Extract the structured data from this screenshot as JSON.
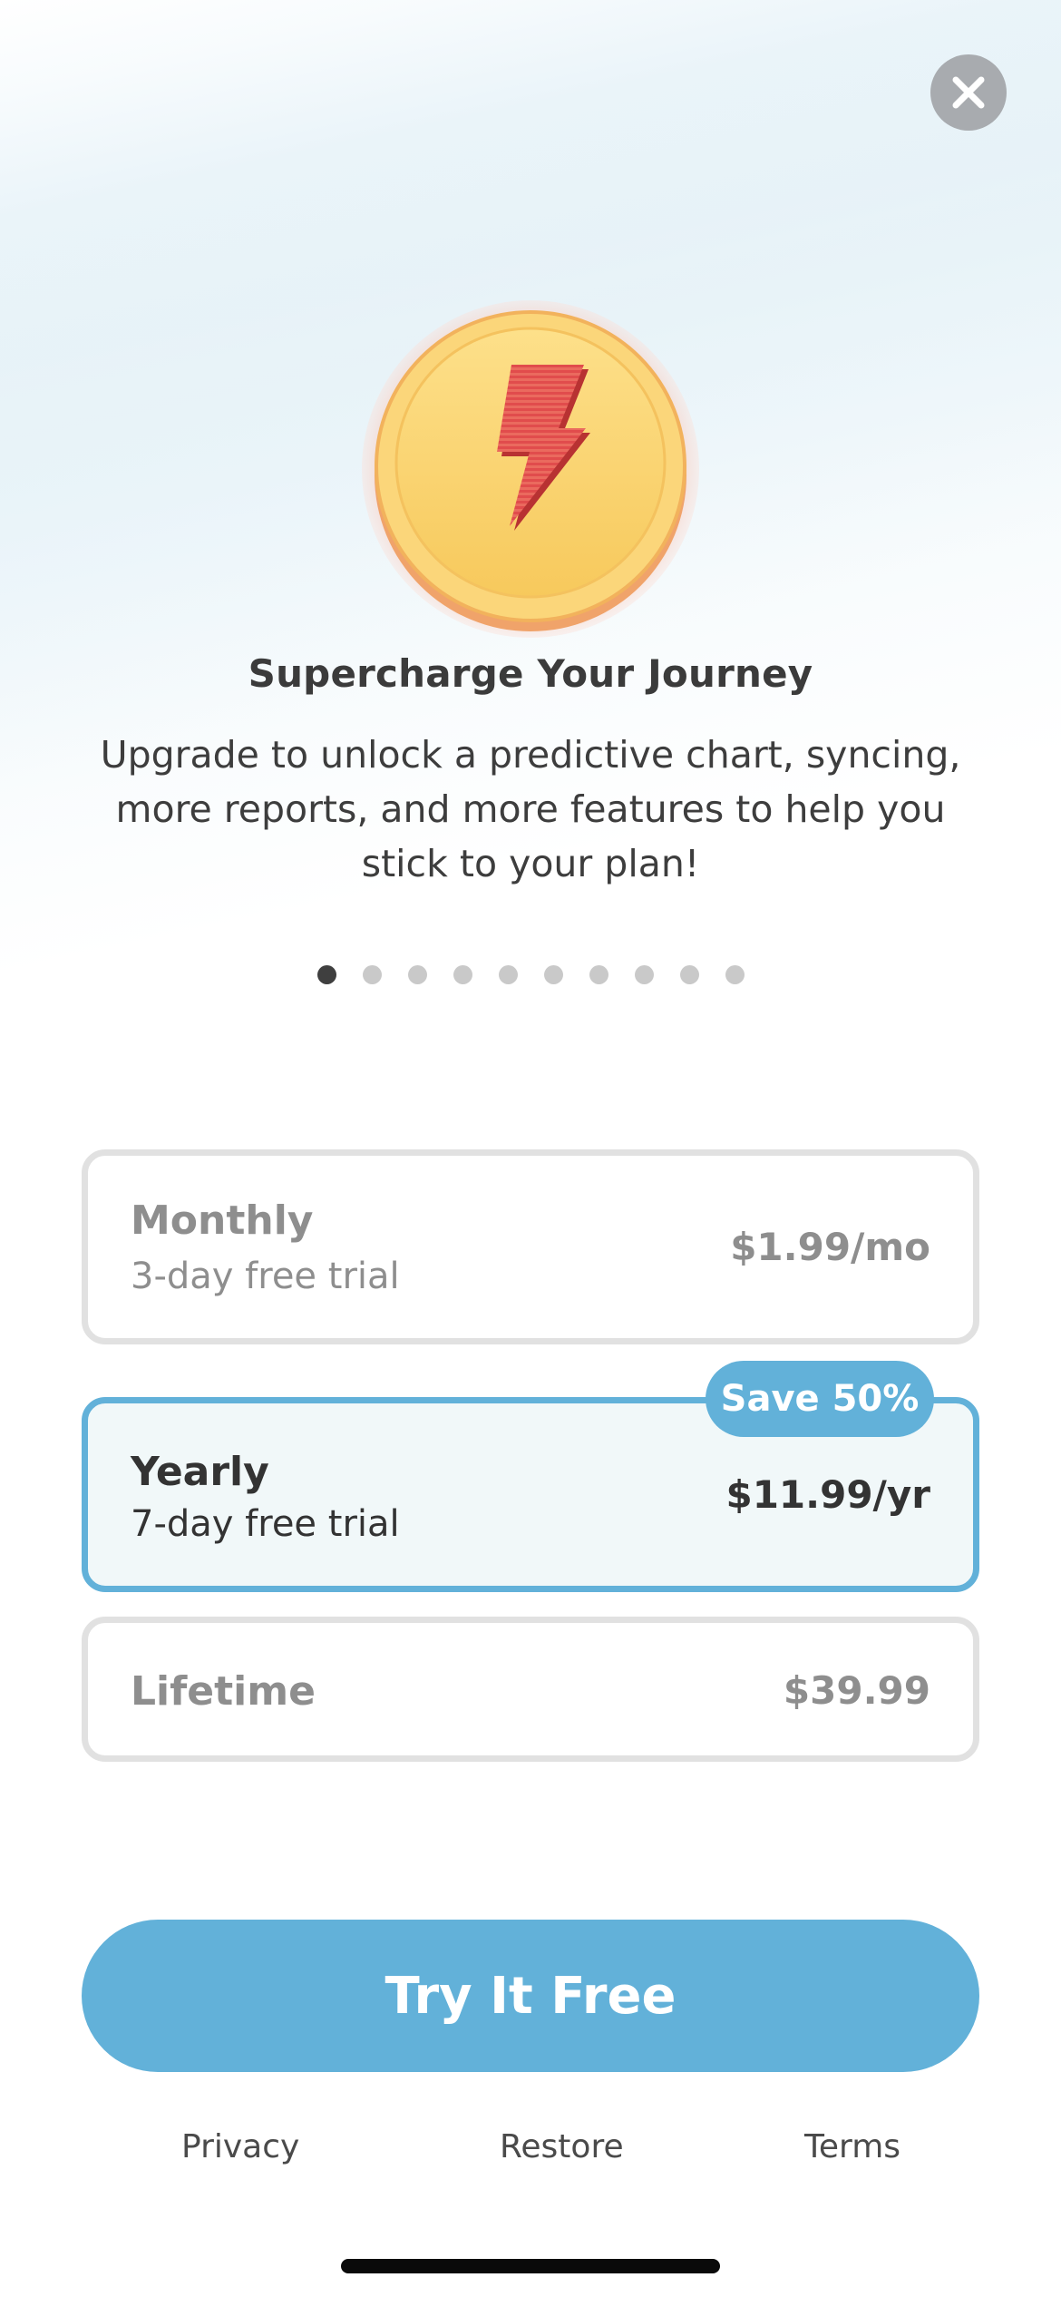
{
  "header": {
    "close_icon": "close-x-icon",
    "hero_icon": "lightning-coin-icon"
  },
  "content": {
    "title": "Supercharge Your Journey",
    "subtitle": "Upgrade to unlock a predictive chart, syncing, more reports, and more features to help you stick to your plan!"
  },
  "pager": {
    "total": 10,
    "active_index": 0
  },
  "plans": [
    {
      "name": "Monthly",
      "trial": "3-day free trial",
      "price": "$1.99/mo",
      "selected": false
    },
    {
      "name": "Yearly",
      "trial": "7-day free trial",
      "price": "$11.99/yr",
      "selected": true,
      "badge": "Save 50%"
    },
    {
      "name": "Lifetime",
      "trial": "",
      "price": "$39.99",
      "selected": false
    }
  ],
  "cta": {
    "label": "Try It Free"
  },
  "footer": {
    "privacy": "Privacy",
    "restore": "Restore",
    "terms": "Terms"
  },
  "colors": {
    "accent": "#62b1d9",
    "selected_bg": "#f1f8f9",
    "unselected_border": "#e1e1e1",
    "close_bg": "#a8abaf"
  }
}
